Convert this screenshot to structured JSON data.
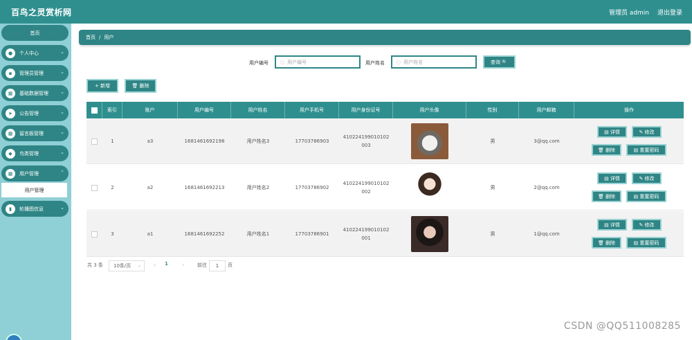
{
  "header": {
    "title": "百鸟之灵赏析网",
    "admin": "管理员 admin",
    "logout": "退出登录"
  },
  "sidebar": {
    "home": "首页",
    "items": [
      {
        "label": "个人中心",
        "icon": "person-icon"
      },
      {
        "label": "管理员管理",
        "icon": "admin-icon"
      },
      {
        "label": "基础数据管理",
        "icon": "grid-icon"
      },
      {
        "label": "公告管理",
        "icon": "send-icon"
      },
      {
        "label": "留言板管理",
        "icon": "apps-icon"
      },
      {
        "label": "鸟类管理",
        "icon": "shield-icon"
      },
      {
        "label": "用户管理",
        "icon": "apps-icon"
      },
      {
        "label": "轮播图信息",
        "icon": "bar-chart-icon"
      }
    ],
    "sub_user": "用户管理"
  },
  "breadcrumb": {
    "home": "首页",
    "sep": "/",
    "current": "用户"
  },
  "search": {
    "label_id": "用户编号",
    "placeholder_id": "用户编号",
    "label_name": "用户姓名",
    "placeholder_name": "用户姓名",
    "button": "查询 🔍"
  },
  "actions": {
    "add": "+ 新增",
    "delete": "🗑 删除"
  },
  "table": {
    "headers": [
      "索引",
      "账户",
      "用户编号",
      "用户姓名",
      "用户手机号",
      "用户身份证号",
      "用户头像",
      "性别",
      "用户邮箱",
      "操作"
    ],
    "rows": [
      {
        "idx": "1",
        "account": "a3",
        "uid": "1681461692198",
        "name": "用户姓名3",
        "phone": "17703786903",
        "idcard1": "410224199010102",
        "idcard2": "003",
        "gender": "男",
        "email": "3@qq.com"
      },
      {
        "idx": "2",
        "account": "a2",
        "uid": "1681461692213",
        "name": "用户姓名2",
        "phone": "17703786902",
        "idcard1": "410224199010102",
        "idcard2": "002",
        "gender": "男",
        "email": "2@qq.com"
      },
      {
        "idx": "3",
        "account": "a1",
        "uid": "1681461692252",
        "name": "用户姓名1",
        "phone": "17703786901",
        "idcard1": "410224199010102",
        "idcard2": "001",
        "gender": "男",
        "email": "1@qq.com"
      }
    ],
    "ops": {
      "detail": "▤ 详情",
      "edit": "✎ 修改",
      "delete": "🗑 删除",
      "reset": "▤ 重置密码"
    }
  },
  "pagination": {
    "total": "共 3 条",
    "page_size": "10条/页",
    "current": "1",
    "goto": "前往",
    "goto_value": "1",
    "page_suffix": "页"
  },
  "watermark": "CSDN @QQ511008285"
}
